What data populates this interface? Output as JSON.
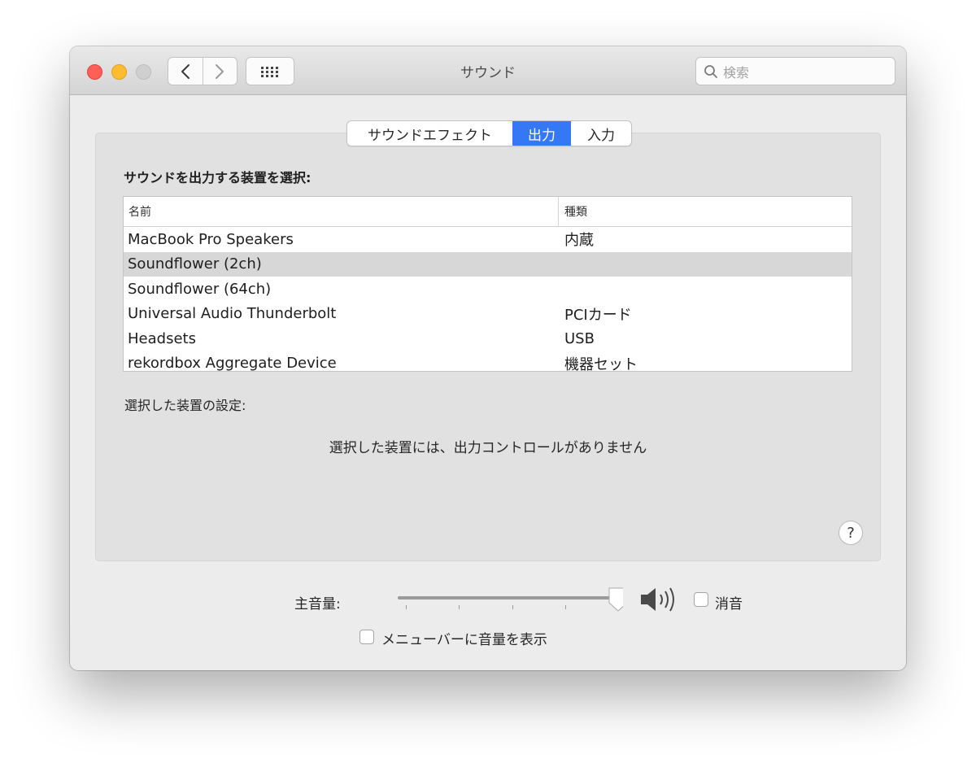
{
  "window": {
    "title": "サウンド"
  },
  "search": {
    "placeholder": "検索"
  },
  "tabs": [
    {
      "label": "サウンドエフェクト",
      "active": false
    },
    {
      "label": "出力",
      "active": true
    },
    {
      "label": "入力",
      "active": false
    }
  ],
  "output": {
    "heading": "サウンドを出力する装置を選択:",
    "columns": {
      "name": "名前",
      "kind": "種類"
    },
    "devices": [
      {
        "name": "MacBook Pro Speakers",
        "kind": "内蔵",
        "selected": false
      },
      {
        "name": "Soundflower (2ch)",
        "kind": "",
        "selected": true
      },
      {
        "name": "Soundflower (64ch)",
        "kind": "",
        "selected": false
      },
      {
        "name": "Universal Audio Thunderbolt",
        "kind": "PCIカード",
        "selected": false
      },
      {
        "name": "Headsets",
        "kind": "USB",
        "selected": false
      },
      {
        "name": "rekordbox Aggregate Device",
        "kind": "機器セット",
        "selected": false
      }
    ],
    "settings_label": "選択した装置の設定:",
    "no_controls": "選択した装置には、出力コントロールがありません",
    "help": "?"
  },
  "volume": {
    "label": "主音量:",
    "level": 1.0,
    "mute_label": "消音",
    "mute_checked": false,
    "menubar_label": "メニューバーに音量を表示",
    "menubar_checked": false
  },
  "colors": {
    "accent": "#3478f6",
    "selected_row": "#d7d7d7",
    "close": "#fe5f57",
    "minimize": "#febc2e"
  }
}
